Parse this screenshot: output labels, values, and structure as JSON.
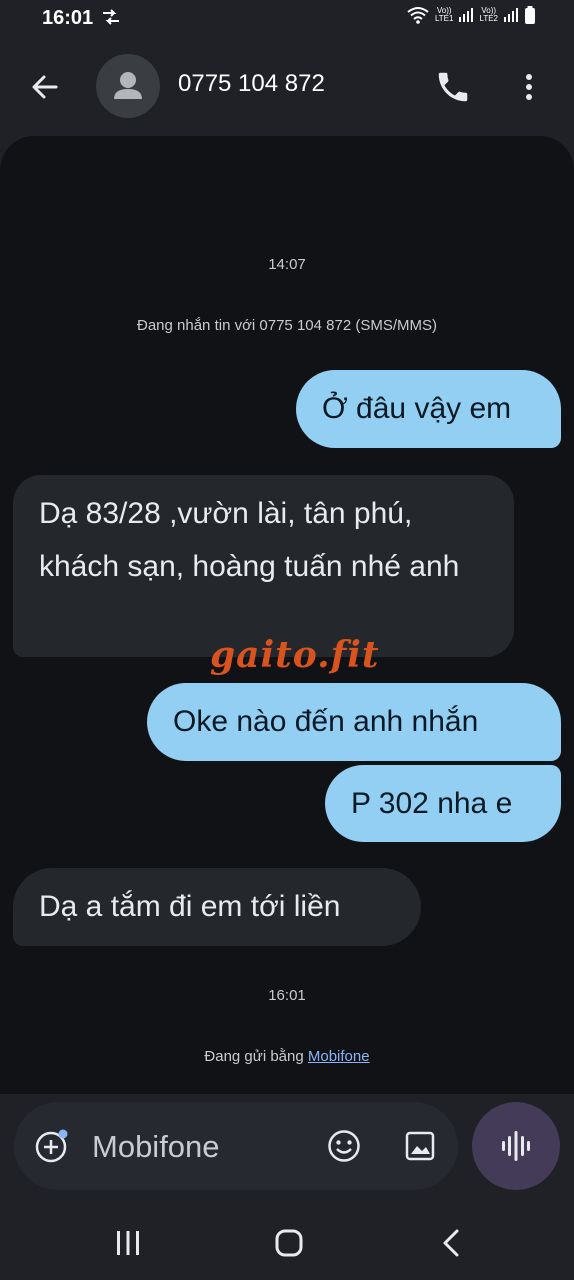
{
  "status_bar": {
    "time": "16:01",
    "sim1_label_top": "Vo))",
    "sim1_label_bottom": "LTE1",
    "sim2_label_top": "Vo))",
    "sim2_label_bottom": "LTE2"
  },
  "header": {
    "title": "0775 104 872"
  },
  "conversation": {
    "timestamp_1": "14:07",
    "info": "Đang nhắn tin với 0775 104 872 (SMS/MMS)",
    "messages": [
      {
        "direction": "sent",
        "text": "Ở đâu vậy em"
      },
      {
        "direction": "received",
        "text": "Dạ 83/28 ,vườn lài, tân phú, khách sạn, hoàng tuấn nhé anh"
      },
      {
        "direction": "sent",
        "text": "Oke nào đến anh nhắn"
      },
      {
        "direction": "sent",
        "text": "P 302 nha e"
      },
      {
        "direction": "received",
        "text": "Dạ a tắm đi em tới liền"
      }
    ],
    "timestamp_2": "16:01",
    "sending_prefix": "Đang gửi bằng ",
    "sending_carrier": "Mobifone",
    "watermark": "gaito.fit"
  },
  "composer": {
    "placeholder": "Mobifone"
  },
  "colors": {
    "sent_bubble": "#93cff3",
    "received_bubble": "#24272c",
    "link": "#8ab4f8",
    "watermark": "#d9531e",
    "voice_button": "#433b57"
  },
  "icons": {
    "back": "arrow-left-icon",
    "avatar": "person-icon",
    "call": "phone-icon",
    "more": "more-vert-icon",
    "add": "add-circle-icon",
    "emoji": "emoji-icon",
    "gallery": "image-icon",
    "voice": "waveform-icon"
  }
}
